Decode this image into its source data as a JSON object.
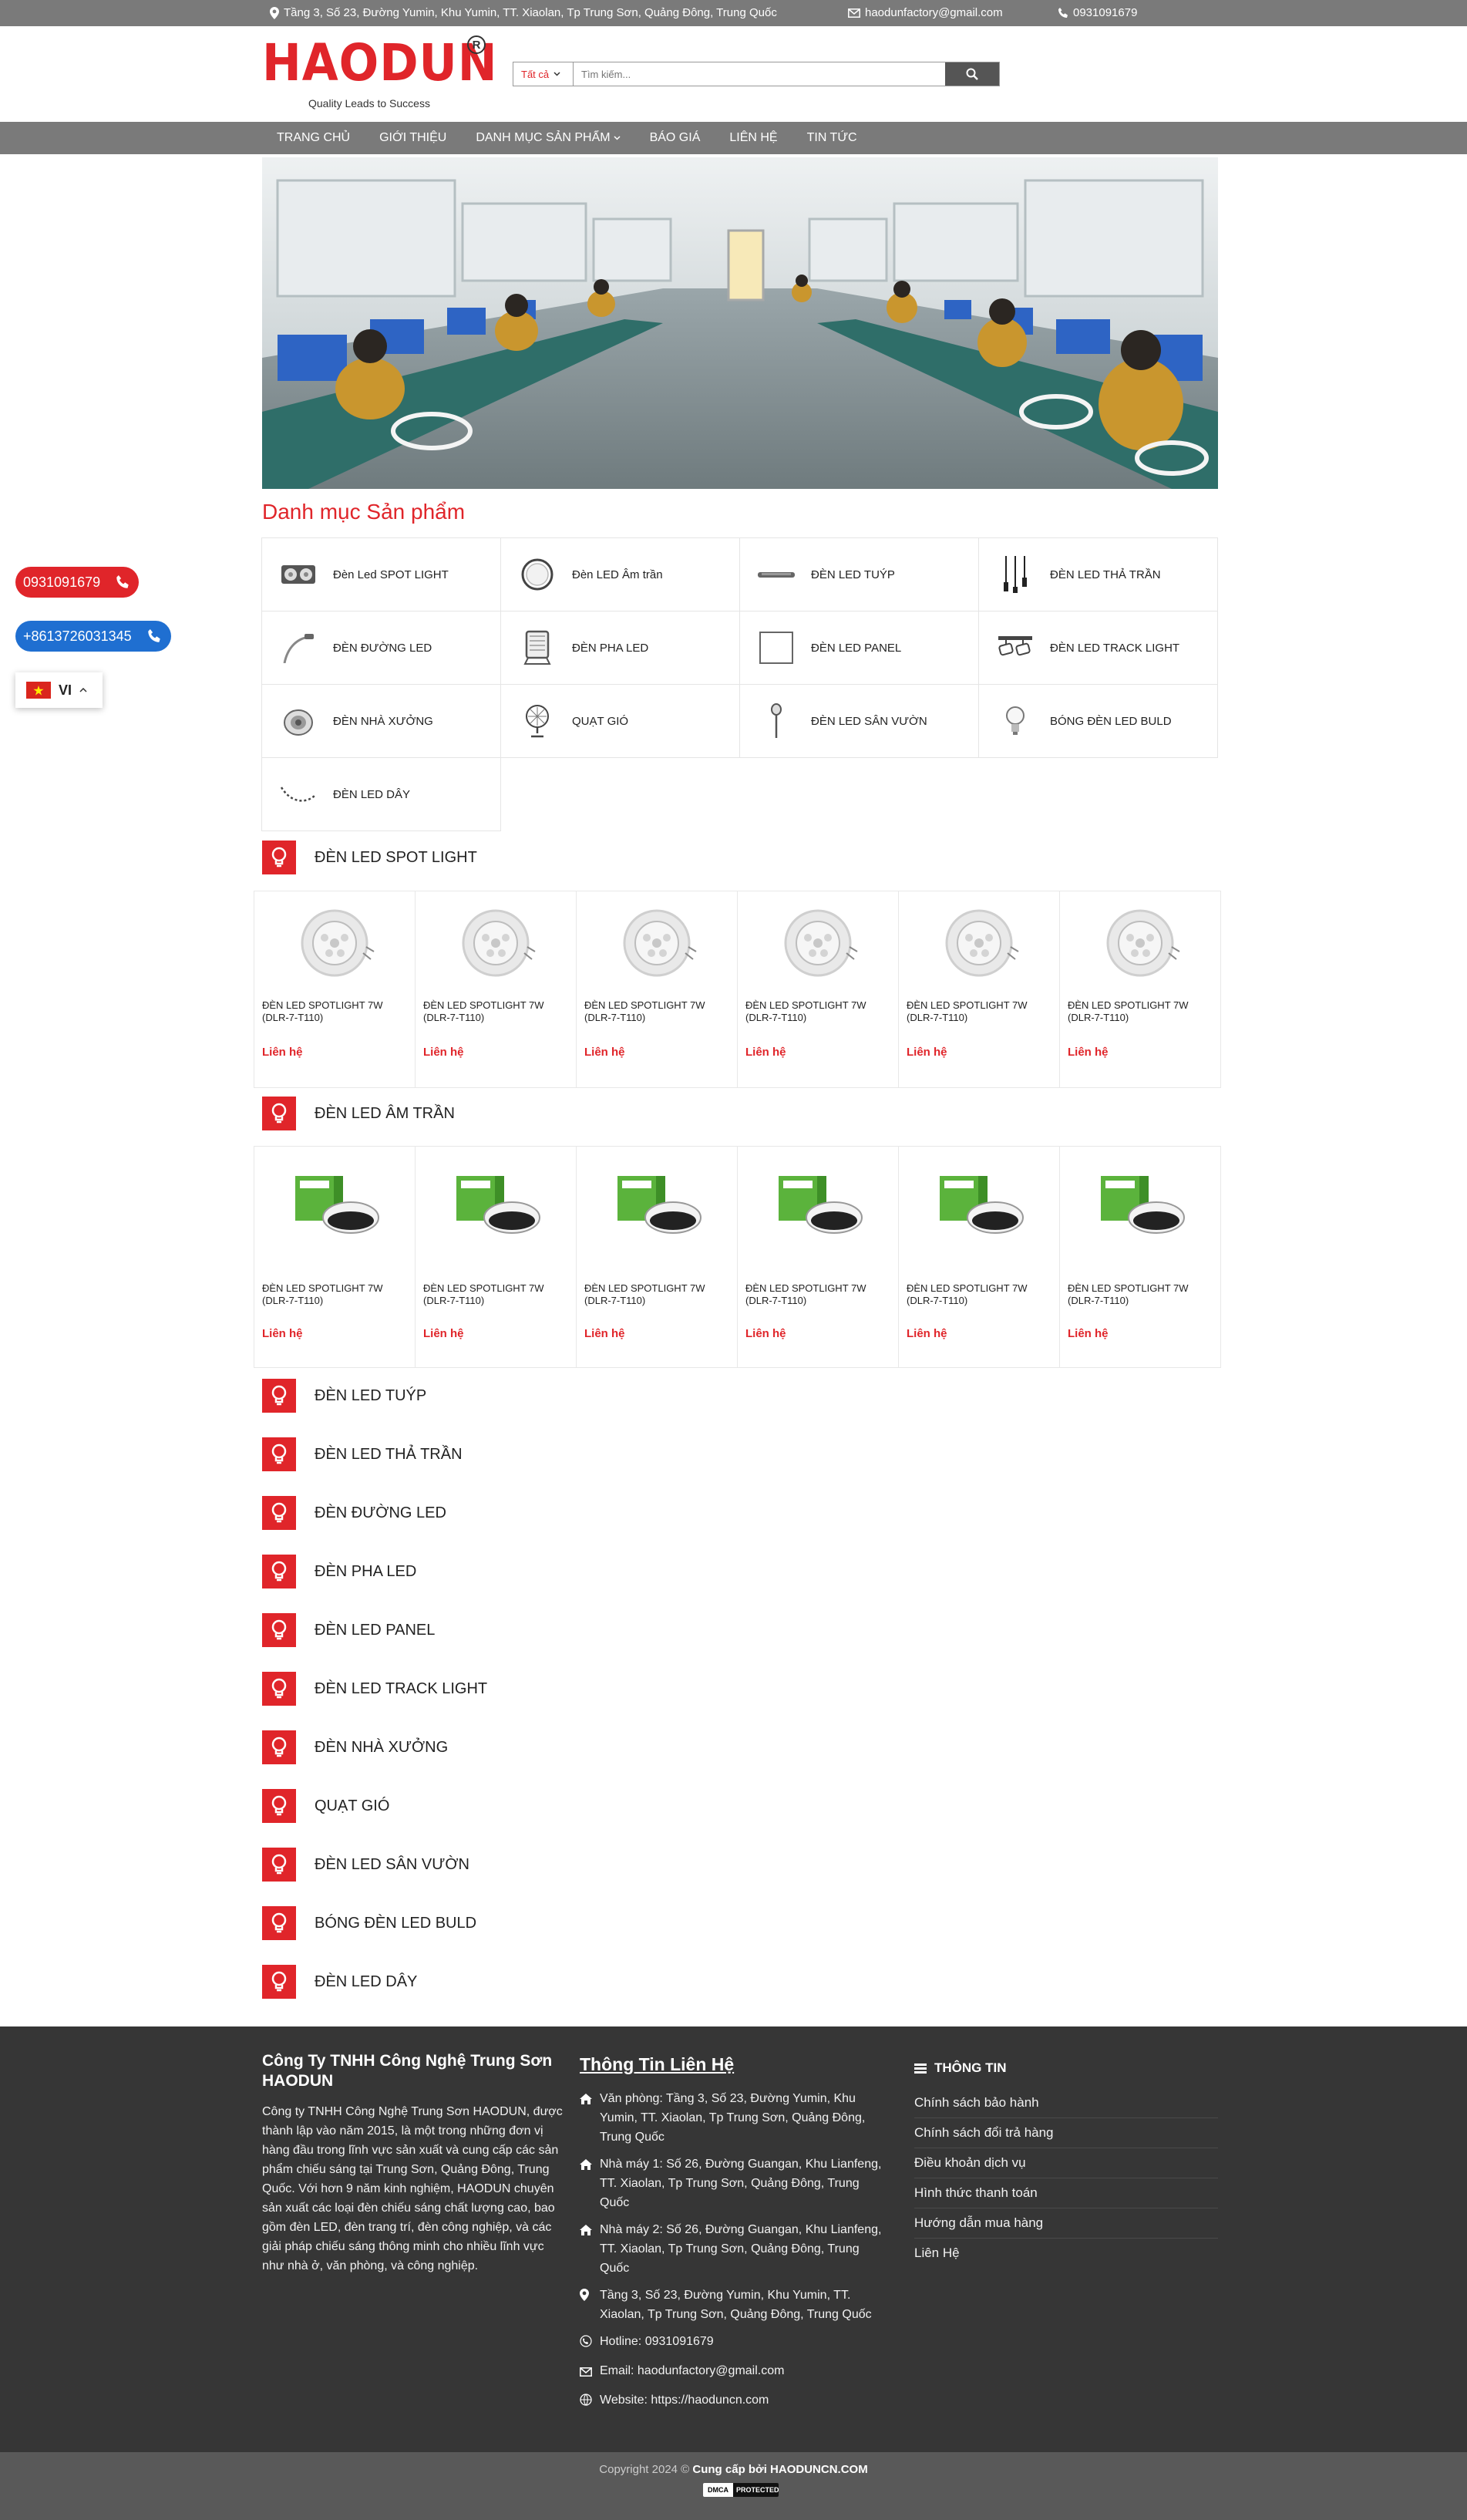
{
  "topbar": {
    "address": "Tầng 3, Số 23, Đường Yumin, Khu Yumin, TT. Xiaolan, Tp Trung Sơn, Quảng Đông, Trung Quốc",
    "email": "haodunfactory@gmail.com",
    "phone": "0931091679"
  },
  "header": {
    "logo_text": "HAODUN",
    "logo_reg": "R",
    "logo_tagline": "Quality Leads to Success",
    "search_category": "Tất cả",
    "search_placeholder": "Tìm kiếm..."
  },
  "nav": {
    "items": [
      "Trang chủ",
      "Giới thiệu",
      "Danh mục sản phẩm",
      "Báo giá",
      "Liên hệ",
      "Tin tức"
    ]
  },
  "categories_title": "Danh mục Sản phẩm",
  "categories": [
    {
      "label": "Đèn Led SPOT LIGHT",
      "icon": "spotlight-icon"
    },
    {
      "label": "Đèn LED Âm trần",
      "icon": "downlight-icon"
    },
    {
      "label": "ĐÈN LED TUÝP",
      "icon": "tube-icon"
    },
    {
      "label": "ĐÈN LED THẢ TRẦN",
      "icon": "pendant-icon"
    },
    {
      "label": "ĐÈN ĐƯỜNG LED",
      "icon": "streetlight-icon"
    },
    {
      "label": "ĐÈN PHA LED",
      "icon": "floodlight-icon"
    },
    {
      "label": "ĐÈN LED PANEL",
      "icon": "panel-icon"
    },
    {
      "label": "ĐÈN LED TRACK LIGHT",
      "icon": "tracklight-icon"
    },
    {
      "label": "ĐÈN NHÀ XƯỞNG",
      "icon": "highbay-icon"
    },
    {
      "label": "QUẠT GIÓ",
      "icon": "fan-icon"
    },
    {
      "label": "ĐÈN LED SÂN VƯỜN",
      "icon": "garden-icon"
    },
    {
      "label": "BÓNG ĐÈN LED BULD",
      "icon": "bulb-icon"
    },
    {
      "label": "ĐÈN LED DÂY",
      "icon": "strip-icon"
    }
  ],
  "product_sections": {
    "spot": {
      "title": "ĐÈN LED SPOT LIGHT",
      "products": [
        {
          "name": "ĐÈN LED SPOTLIGHT 7W (DLR-7-T110)",
          "price": "Liên hệ"
        },
        {
          "name": "ĐÈN LED SPOTLIGHT 7W (DLR-7-T110)",
          "price": "Liên hệ"
        },
        {
          "name": "ĐÈN LED SPOTLIGHT 7W (DLR-7-T110)",
          "price": "Liên hệ"
        },
        {
          "name": "ĐÈN LED SPOTLIGHT 7W (DLR-7-T110)",
          "price": "Liên hệ"
        },
        {
          "name": "ĐÈN LED SPOTLIGHT 7W (DLR-7-T110)",
          "price": "Liên hệ"
        },
        {
          "name": "ĐÈN LED SPOTLIGHT 7W (DLR-7-T110)",
          "price": "Liên hệ"
        }
      ]
    },
    "amtran": {
      "title": "ĐÈN LED ÂM TRẦN",
      "products": [
        {
          "name": "ĐÈN LED SPOTLIGHT 7W (DLR-7-T110)",
          "price": "Liên hệ"
        },
        {
          "name": "ĐÈN LED SPOTLIGHT 7W (DLR-7-T110)",
          "price": "Liên hệ"
        },
        {
          "name": "ĐÈN LED SPOTLIGHT 7W (DLR-7-T110)",
          "price": "Liên hệ"
        },
        {
          "name": "ĐÈN LED SPOTLIGHT 7W (DLR-7-T110)",
          "price": "Liên hệ"
        },
        {
          "name": "ĐÈN LED SPOTLIGHT 7W (DLR-7-T110)",
          "price": "Liên hệ"
        },
        {
          "name": "ĐÈN LED SPOTLIGHT 7W (DLR-7-T110)",
          "price": "Liên hệ"
        }
      ]
    },
    "empty": [
      "ĐÈN LED TUÝP",
      "ĐÈN LED THẢ TRẦN",
      "ĐÈN ĐƯỜNG LED",
      "ĐÈN PHA LED",
      "ĐÈN LED PANEL",
      "ĐÈN LED TRACK LIGHT",
      "ĐÈN NHÀ XƯỞNG",
      "QUẠT GIÓ",
      "ĐÈN LED SÂN VƯỜN",
      "BÓNG ĐÈN LED BULD",
      "ĐÈN LED DÂY"
    ]
  },
  "floating": {
    "phone1": "0931091679",
    "phone2": "+8613726031345",
    "lang": "VI"
  },
  "footer": {
    "company_title": "Công Ty TNHH Công Nghệ Trung Sơn HAODUN",
    "company_desc": "Công ty TNHH Công Nghệ Trung Sơn HAODUN, được thành lập vào năm 2015, là một trong những đơn vị hàng đầu trong lĩnh vực sản xuất và cung cấp các sản phẩm chiếu sáng tại Trung Sơn, Quảng Đông, Trung Quốc. Với hơn 9 năm kinh nghiệm, HAODUN chuyên sản xuất các loại đèn chiếu sáng chất lượng cao, bao gồm đèn LED, đèn trang trí, đèn công nghiệp, và các giải pháp chiếu sáng thông minh cho nhiều lĩnh vực như nhà ở, văn phòng, và công nghiệp.",
    "contact_title": "Thông Tin Liên Hệ",
    "contact_office": "Văn phòng: Tầng 3, Số 23, Đường Yumin, Khu Yumin, TT. Xiaolan, Tp Trung Sơn, Quảng Đông, Trung Quốc",
    "contact_factory1": "Nhà máy 1: Số 26, Đường Guangan, Khu Lianfeng, TT. Xiaolan, Tp Trung Sơn, Quảng Đông, Trung Quốc",
    "contact_factory2": "Nhà máy 2: Số 26, Đường Guangan, Khu Lianfeng, TT. Xiaolan, Tp Trung Sơn, Quảng Đông, Trung Quốc",
    "contact_address": "Tầng 3, Số 23, Đường Yumin, Khu Yumin, TT. Xiaolan, Tp Trung Sơn, Quảng Đông, Trung Quốc",
    "contact_hotline": "Hotline: 0931091679",
    "contact_email": "Email: haodunfactory@gmail.com",
    "contact_website": "Website: https://haoduncn.com",
    "info_title": "THÔNG TIN",
    "info_links": [
      "Chính sách bảo hành",
      "Chính sách đổi trả hàng",
      "Điều khoản dịch vụ",
      "Hình thức thanh toán",
      "Hướng dẫn mua hàng",
      "Liên Hệ"
    ],
    "copyright": "Copyright 2024 ©",
    "copyright_by": "Cung cấp bởi HAODUNCN.COM",
    "dmca_left": "DMCA",
    "dmca_right": "PROTECTED"
  },
  "colors": {
    "brand_red": "#e0252a",
    "bar_gray": "#7a7a7a",
    "footer_dark": "#363636",
    "phone2_blue": "#1f6fd1"
  }
}
